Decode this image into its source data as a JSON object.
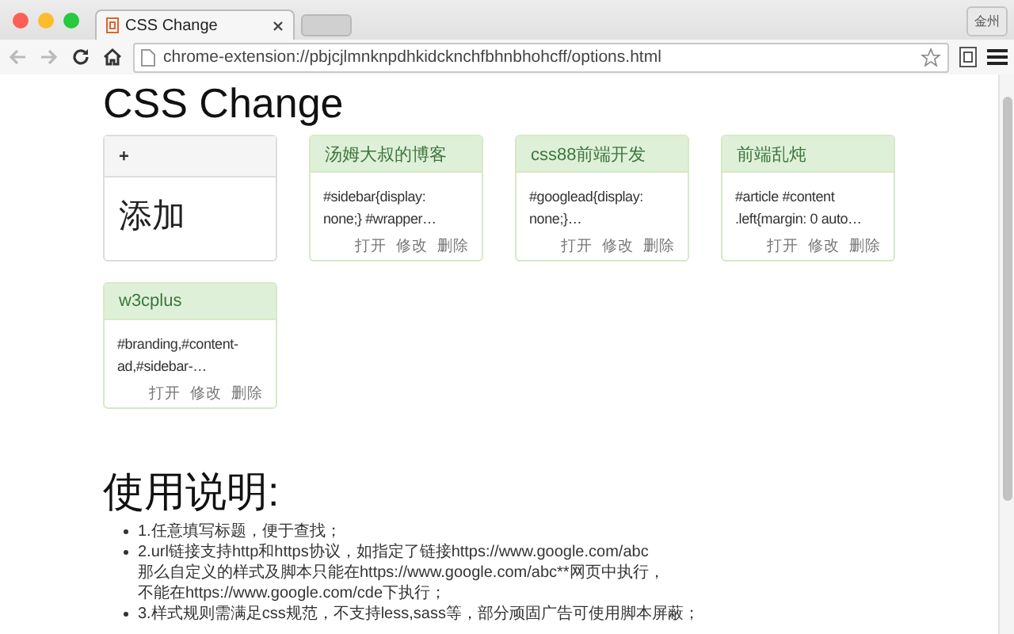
{
  "window": {
    "tab_title": "CSS Change",
    "profile": "金州",
    "url": "chrome-extension://pbjcjlmnknpdhkidcknchfbhnbhohcff/options.html",
    "bookmarked": false
  },
  "page": {
    "title": "CSS Change",
    "add_card": {
      "header": "+",
      "label": "添加"
    },
    "cards": [
      {
        "title": "汤姆大叔的博客",
        "css": [
          "#sidebar{display:",
          "none;} #wrapper…"
        ],
        "actions": [
          "打开",
          "修改",
          "删除"
        ]
      },
      {
        "title": "css88前端开发",
        "css": [
          "#googlead{display:",
          "none;}…"
        ],
        "actions": [
          "打开",
          "修改",
          "删除"
        ]
      },
      {
        "title": "前端乱炖",
        "css": [
          "#article #content",
          ".left{margin: 0 auto…"
        ],
        "actions": [
          "打开",
          "修改",
          "删除"
        ]
      },
      {
        "title": "w3cplus",
        "css": [
          "#branding,#content-",
          "ad,#sidebar-…"
        ],
        "actions": [
          "打开",
          "修改",
          "删除"
        ]
      }
    ],
    "usage": {
      "heading": "使用说明:",
      "items": [
        {
          "lines": [
            "1.任意填写标题，便于查找；"
          ]
        },
        {
          "lines": [
            "2.url链接支持http和https协议，如指定了链接https://www.google.com/abc",
            "那么自定义的样式及脚本只能在https://www.google.com/abc**网页中执行，",
            "不能在https://www.google.com/cde下执行；"
          ]
        },
        {
          "lines": [
            "3.样式规则需满足css规范，不支持less,sass等，部分顽固广告可使用脚本屏蔽；"
          ]
        }
      ]
    }
  }
}
